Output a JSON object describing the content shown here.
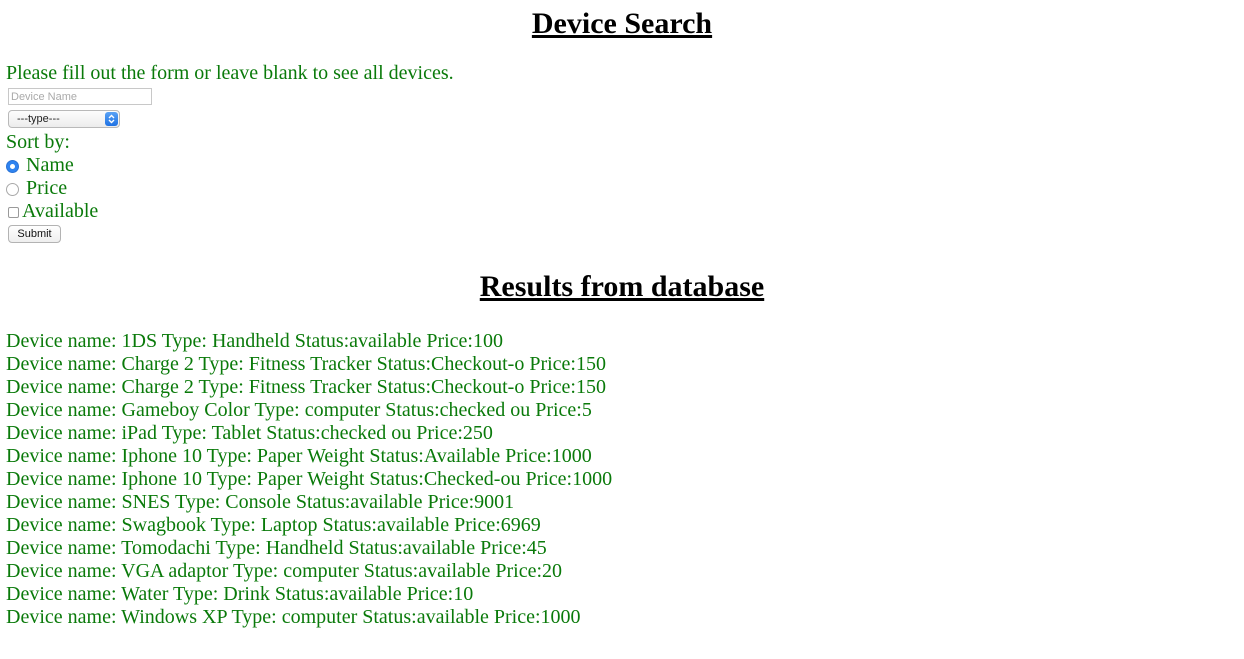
{
  "header": {
    "title": "Device Search"
  },
  "form": {
    "instructions": "Please fill out the form or leave blank to see all devices.",
    "device_name_placeholder": "Device Name",
    "device_name_value": "",
    "type_select_value": "---type---",
    "sort_label": "Sort by:",
    "sort_options": [
      {
        "label": "Name",
        "selected": true
      },
      {
        "label": "Price",
        "selected": false
      }
    ],
    "available_label": "Available",
    "available_checked": false,
    "submit_label": "Submit"
  },
  "results": {
    "title": "Results from database",
    "rows": [
      "Device name: 1DS Type: Handheld Status:available Price:100",
      "Device name: Charge 2 Type: Fitness Tracker Status:Checkout-o Price:150",
      "Device name: Charge 2 Type: Fitness Tracker Status:Checkout-o Price:150",
      "Device name: Gameboy Color Type: computer Status:checked ou Price:5",
      "Device name: iPad Type: Tablet Status:checked ou Price:250",
      "Device name: Iphone 10 Type: Paper Weight Status:Available Price:1000",
      "Device name: Iphone 10 Type: Paper Weight Status:Checked-ou Price:1000",
      "Device name: SNES Type: Console Status:available Price:9001",
      "Device name: Swagbook Type: Laptop Status:available Price:6969",
      "Device name: Tomodachi Type: Handheld Status:available Price:45",
      "Device name: VGA adaptor Type: computer Status:available Price:20",
      "Device name: Water Type: Drink Status:available Price:10",
      "Device name: Windows XP Type: computer Status:available Price:1000"
    ]
  },
  "colors": {
    "text_green": "#0a7a0a",
    "heading": "#000000",
    "radio_selected": "#2e83f0"
  },
  "icons": {
    "select_arrow": "chevron-up-down-icon"
  }
}
